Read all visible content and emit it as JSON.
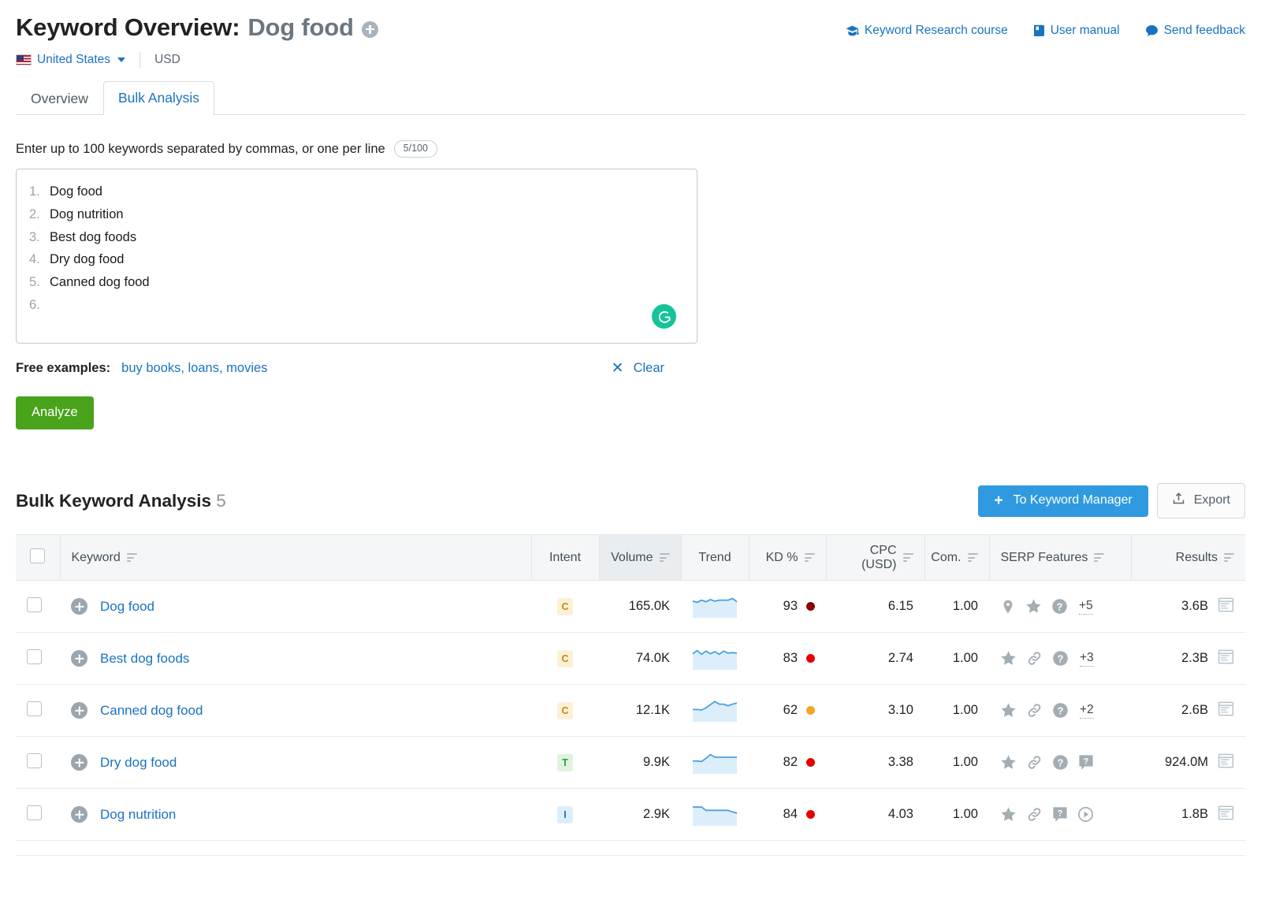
{
  "header": {
    "title_prefix": "Keyword Overview:",
    "keyword": "Dog food",
    "add_icon": "plus-circle-icon",
    "links": [
      {
        "label": "Keyword Research course",
        "icon": "graduation-cap-icon"
      },
      {
        "label": "User manual",
        "icon": "book-icon"
      },
      {
        "label": "Send feedback",
        "icon": "chat-bubble-icon"
      }
    ]
  },
  "locale": {
    "country": "United States",
    "flag_icon": "us-flag-icon",
    "caret_icon": "chevron-down-icon",
    "currency": "USD"
  },
  "tabs": [
    {
      "label": "Overview",
      "active": false
    },
    {
      "label": "Bulk Analysis",
      "active": true
    }
  ],
  "entry": {
    "instruction": "Enter up to 100 keywords separated by commas, or one per line",
    "counter": "5/100",
    "lines": [
      {
        "num": "1.",
        "text": "Dog food"
      },
      {
        "num": "2.",
        "text": "Dog nutrition"
      },
      {
        "num": "3.",
        "text": "Best dog foods"
      },
      {
        "num": "4.",
        "text": "Dry dog food"
      },
      {
        "num": "5.",
        "text": "Canned dog food"
      },
      {
        "num": "6.",
        "text": ""
      }
    ],
    "grammarly_icon": "grammarly-g-icon",
    "examples_label": "Free examples:",
    "examples_link": "buy books, loans, movies",
    "clear_label": "Clear",
    "clear_icon": "close-x-icon",
    "analyze_label": "Analyze"
  },
  "results": {
    "title": "Bulk Keyword Analysis",
    "count": "5",
    "to_keyword_manager": "To Keyword Manager",
    "export_label": "Export",
    "export_icon": "upload-icon",
    "columns": [
      {
        "key": "check",
        "label": "",
        "sortable": false
      },
      {
        "key": "keyword",
        "label": "Keyword",
        "sortable": true
      },
      {
        "key": "intent",
        "label": "Intent",
        "sortable": false
      },
      {
        "key": "volume",
        "label": "Volume",
        "sortable": true
      },
      {
        "key": "trend",
        "label": "Trend",
        "sortable": false
      },
      {
        "key": "kd",
        "label": "KD %",
        "sortable": true
      },
      {
        "key": "cpc",
        "label": "CPC (USD)",
        "sortable": true
      },
      {
        "key": "com",
        "label": "Com.",
        "sortable": true
      },
      {
        "key": "serp",
        "label": "SERP Features",
        "sortable": true
      },
      {
        "key": "results",
        "label": "Results",
        "sortable": true
      }
    ],
    "rows": [
      {
        "keyword": "Dog food",
        "intent": "C",
        "volume": "165.0K",
        "trend": [
          62,
          58,
          66,
          60,
          68,
          62,
          66,
          66,
          66,
          72,
          60
        ],
        "kd": "93",
        "kd_color": "#8b0000",
        "cpc": "6.15",
        "com": "1.00",
        "serp_icons": [
          "map-pin-icon",
          "star-icon",
          "question-circle-icon"
        ],
        "serp_more": "+5",
        "results": "3.6B",
        "results_icon": "serp-page-icon"
      },
      {
        "keyword": "Best dog foods",
        "intent": "C",
        "volume": "74.0K",
        "trend": [
          60,
          72,
          58,
          70,
          60,
          68,
          58,
          70,
          62,
          64,
          62
        ],
        "kd": "83",
        "kd_color": "#e60000",
        "cpc": "2.74",
        "com": "1.00",
        "serp_icons": [
          "star-icon",
          "link-icon",
          "question-circle-icon"
        ],
        "serp_more": "+3",
        "results": "2.3B",
        "results_icon": "serp-page-icon"
      },
      {
        "keyword": "Canned dog food",
        "intent": "C",
        "volume": "12.1K",
        "trend": [
          46,
          46,
          44,
          52,
          64,
          76,
          66,
          66,
          60,
          66,
          70
        ],
        "kd": "62",
        "kd_color": "#f5a623",
        "cpc": "3.10",
        "com": "1.00",
        "serp_icons": [
          "star-icon",
          "link-icon",
          "question-circle-icon"
        ],
        "serp_more": "+2",
        "results": "2.6B",
        "results_icon": "serp-page-icon"
      },
      {
        "keyword": "Dry dog food",
        "intent": "T",
        "volume": "9.9K",
        "trend": [
          48,
          48,
          46,
          58,
          72,
          62,
          62,
          62,
          62,
          62,
          62
        ],
        "kd": "82",
        "kd_color": "#e60000",
        "cpc": "3.38",
        "com": "1.00",
        "serp_icons": [
          "star-icon",
          "link-icon",
          "question-circle-icon",
          "faq-bubble-icon"
        ],
        "serp_more": "",
        "results": "924.0M",
        "results_icon": "serp-page-icon"
      },
      {
        "keyword": "Dog nutrition",
        "intent": "I",
        "volume": "2.9K",
        "trend": [
          70,
          70,
          70,
          58,
          58,
          58,
          58,
          58,
          58,
          52,
          48
        ],
        "kd": "84",
        "kd_color": "#e60000",
        "cpc": "4.03",
        "com": "1.00",
        "serp_icons": [
          "star-icon",
          "link-icon",
          "faq-bubble-icon",
          "video-play-icon"
        ],
        "serp_more": "",
        "results": "1.8B",
        "results_icon": "serp-page-icon"
      }
    ]
  },
  "colors": {
    "link_blue": "#1a73c0",
    "accent_blue": "#2f9ae0",
    "green_button": "#49a31b",
    "grammarly_green": "#15c39a",
    "trend_line": "#4a9fe0",
    "trend_fill": "#ddeefb"
  }
}
